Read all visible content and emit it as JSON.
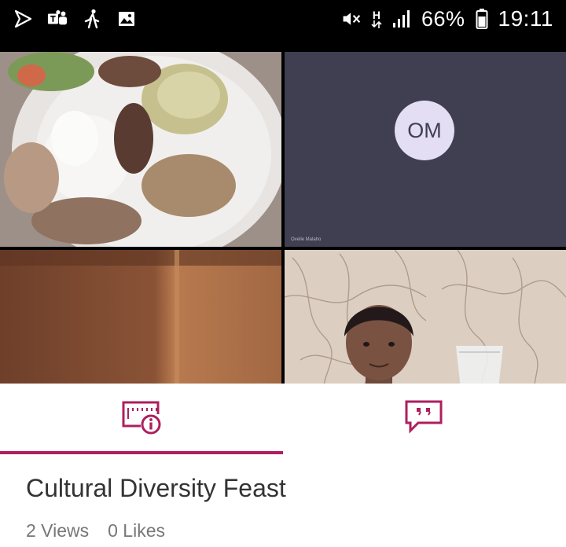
{
  "status_bar": {
    "left_icons": [
      "play-outline-icon",
      "teams-icon",
      "walking-icon",
      "image-icon"
    ],
    "right_icons": [
      "mute-icon",
      "network-h-icon",
      "signal-icon",
      "battery-icon"
    ],
    "network": "H",
    "battery": "66%",
    "time": "19:11"
  },
  "meeting": {
    "participants": [
      {
        "type": "video",
        "description_icon": "food-video"
      },
      {
        "type": "avatar",
        "initials": "OM",
        "name_label": "Ovelle Malaho"
      },
      {
        "type": "video",
        "description_icon": "wall-video"
      },
      {
        "type": "video",
        "description_icon": "child-video"
      }
    ]
  },
  "tabs": [
    {
      "icon": "info-details-icon",
      "selected": true
    },
    {
      "icon": "comments-icon",
      "selected": false
    }
  ],
  "video": {
    "title": "Cultural Diversity Feast",
    "views": "2 Views",
    "likes": "0 Likes"
  },
  "colors": {
    "accent": "#ad1f5e",
    "status_bar": "#000000",
    "avatar_bg": "#e3def4",
    "tile_bg": "#3f3f51"
  }
}
